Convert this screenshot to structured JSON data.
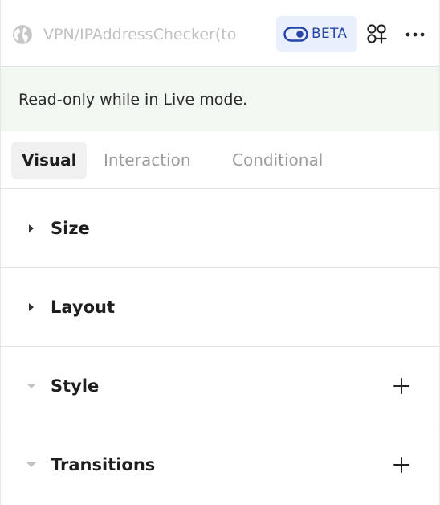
{
  "header": {
    "globe_icon": "globe-icon",
    "title": "VPN/IPAddressChecker(to",
    "beta": {
      "icon": "toggle-icon",
      "label": "BETA",
      "bg_color": "#eaf0fb",
      "text_color": "#2645a8"
    },
    "components_icon": "components-icon",
    "more_icon": "more-horizontal-icon"
  },
  "notice": {
    "text": "Read-only while in Live mode.",
    "bg_color": "#f1f7f1"
  },
  "tabs": [
    {
      "label": "Visual",
      "active": true
    },
    {
      "label": "Interaction",
      "active": false
    },
    {
      "label": "Conditional",
      "active": false
    }
  ],
  "sections": [
    {
      "label": "Size",
      "expanded": false,
      "disabled_caret": false,
      "has_add": false
    },
    {
      "label": "Layout",
      "expanded": false,
      "disabled_caret": false,
      "has_add": false
    },
    {
      "label": "Style",
      "expanded": true,
      "disabled_caret": true,
      "has_add": true
    },
    {
      "label": "Transitions",
      "expanded": true,
      "disabled_caret": true,
      "has_add": true
    }
  ]
}
